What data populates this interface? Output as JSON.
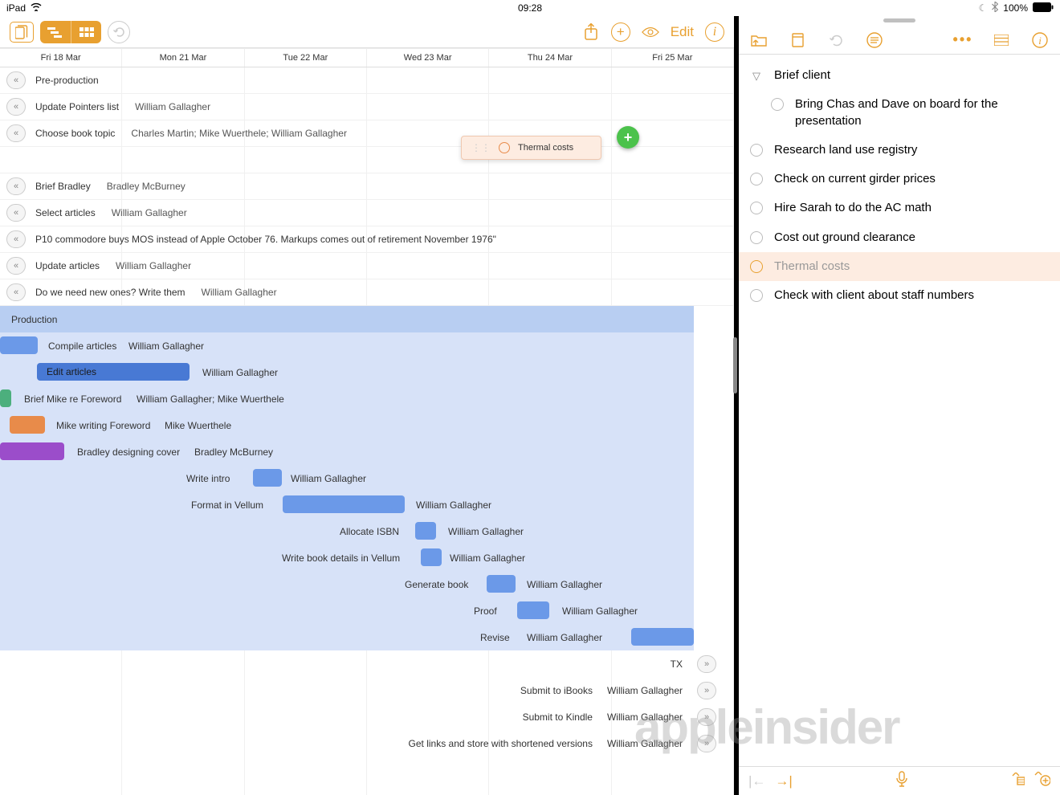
{
  "status": {
    "device": "iPad",
    "time": "09:28",
    "battery": "100%"
  },
  "leftApp": {
    "toolbar": {
      "editLabel": "Edit"
    },
    "dates": [
      "Fri 18 Mar",
      "Mon 21 Mar",
      "Tue 22 Mar",
      "Wed 23 Mar",
      "Thu 24 Mar",
      "Fri 25 Mar"
    ],
    "preRows": [
      {
        "label": "Pre-production",
        "assignee": ""
      },
      {
        "label": "Update Pointers list",
        "assignee": "William Gallagher"
      },
      {
        "label": "Choose book topic",
        "assignee": "Charles Martin; Mike Wuerthele; William Gallagher"
      }
    ],
    "midRows": [
      {
        "label": "Brief Bradley",
        "assignee": "Bradley McBurney"
      },
      {
        "label": "Select articles",
        "assignee": "William Gallagher"
      },
      {
        "label": "P10 commodore buys MOS instead of Apple October 76. Markups comes out of retirement November 1976\"",
        "assignee": ""
      },
      {
        "label": "Update articles",
        "assignee": "William Gallagher"
      },
      {
        "label": "Do we need new ones? Write them",
        "assignee": "William Gallagher"
      }
    ],
    "production": {
      "label": "Production"
    },
    "prodTasks": {
      "compile": {
        "label": "Compile articles",
        "assignee": "William Gallagher"
      },
      "edit": {
        "label": "Edit articles",
        "assignee": "William Gallagher"
      },
      "briefMike": {
        "label": "Brief Mike re Foreword",
        "assignee": "William Gallagher; Mike Wuerthele"
      },
      "mikeWriting": {
        "label": "Mike writing Foreword",
        "assignee": "Mike Wuerthele"
      },
      "bradley": {
        "label": "Bradley designing cover",
        "assignee": "Bradley McBurney"
      },
      "writeIntro": {
        "label": "Write intro",
        "assignee": "William Gallagher"
      },
      "formatVellum": {
        "label": "Format in Vellum",
        "assignee": "William Gallagher"
      },
      "allocateISBN": {
        "label": "Allocate ISBN",
        "assignee": "William Gallagher"
      },
      "writeDetails": {
        "label": "Write book details in Vellum",
        "assignee": "William Gallagher"
      },
      "generate": {
        "label": "Generate book",
        "assignee": "William Gallagher"
      },
      "proof": {
        "label": "Proof",
        "assignee": "William Gallagher"
      },
      "revise": {
        "label": "Revise",
        "assignee": "William Gallagher"
      }
    },
    "postTasks": {
      "tx": {
        "label": "TX"
      },
      "submitIbooks": {
        "label": "Submit to iBooks",
        "assignee": "William Gallagher"
      },
      "submitKindle": {
        "label": "Submit to Kindle",
        "assignee": "William Gallagher"
      },
      "getLinks": {
        "label": "Get links and store with shortened versions",
        "assignee": "William Gallagher"
      }
    },
    "floating": {
      "label": "Thermal costs"
    }
  },
  "rightApp": {
    "header": "Brief client",
    "items": [
      "Bring Chas and Dave on board for the presentation",
      "Research land use registry",
      "Check on current girder prices",
      "Hire Sarah to do the AC math",
      "Cost out ground clearance",
      "Thermal costs",
      "Check with client about staff numbers"
    ]
  },
  "watermark": "appleinsider"
}
